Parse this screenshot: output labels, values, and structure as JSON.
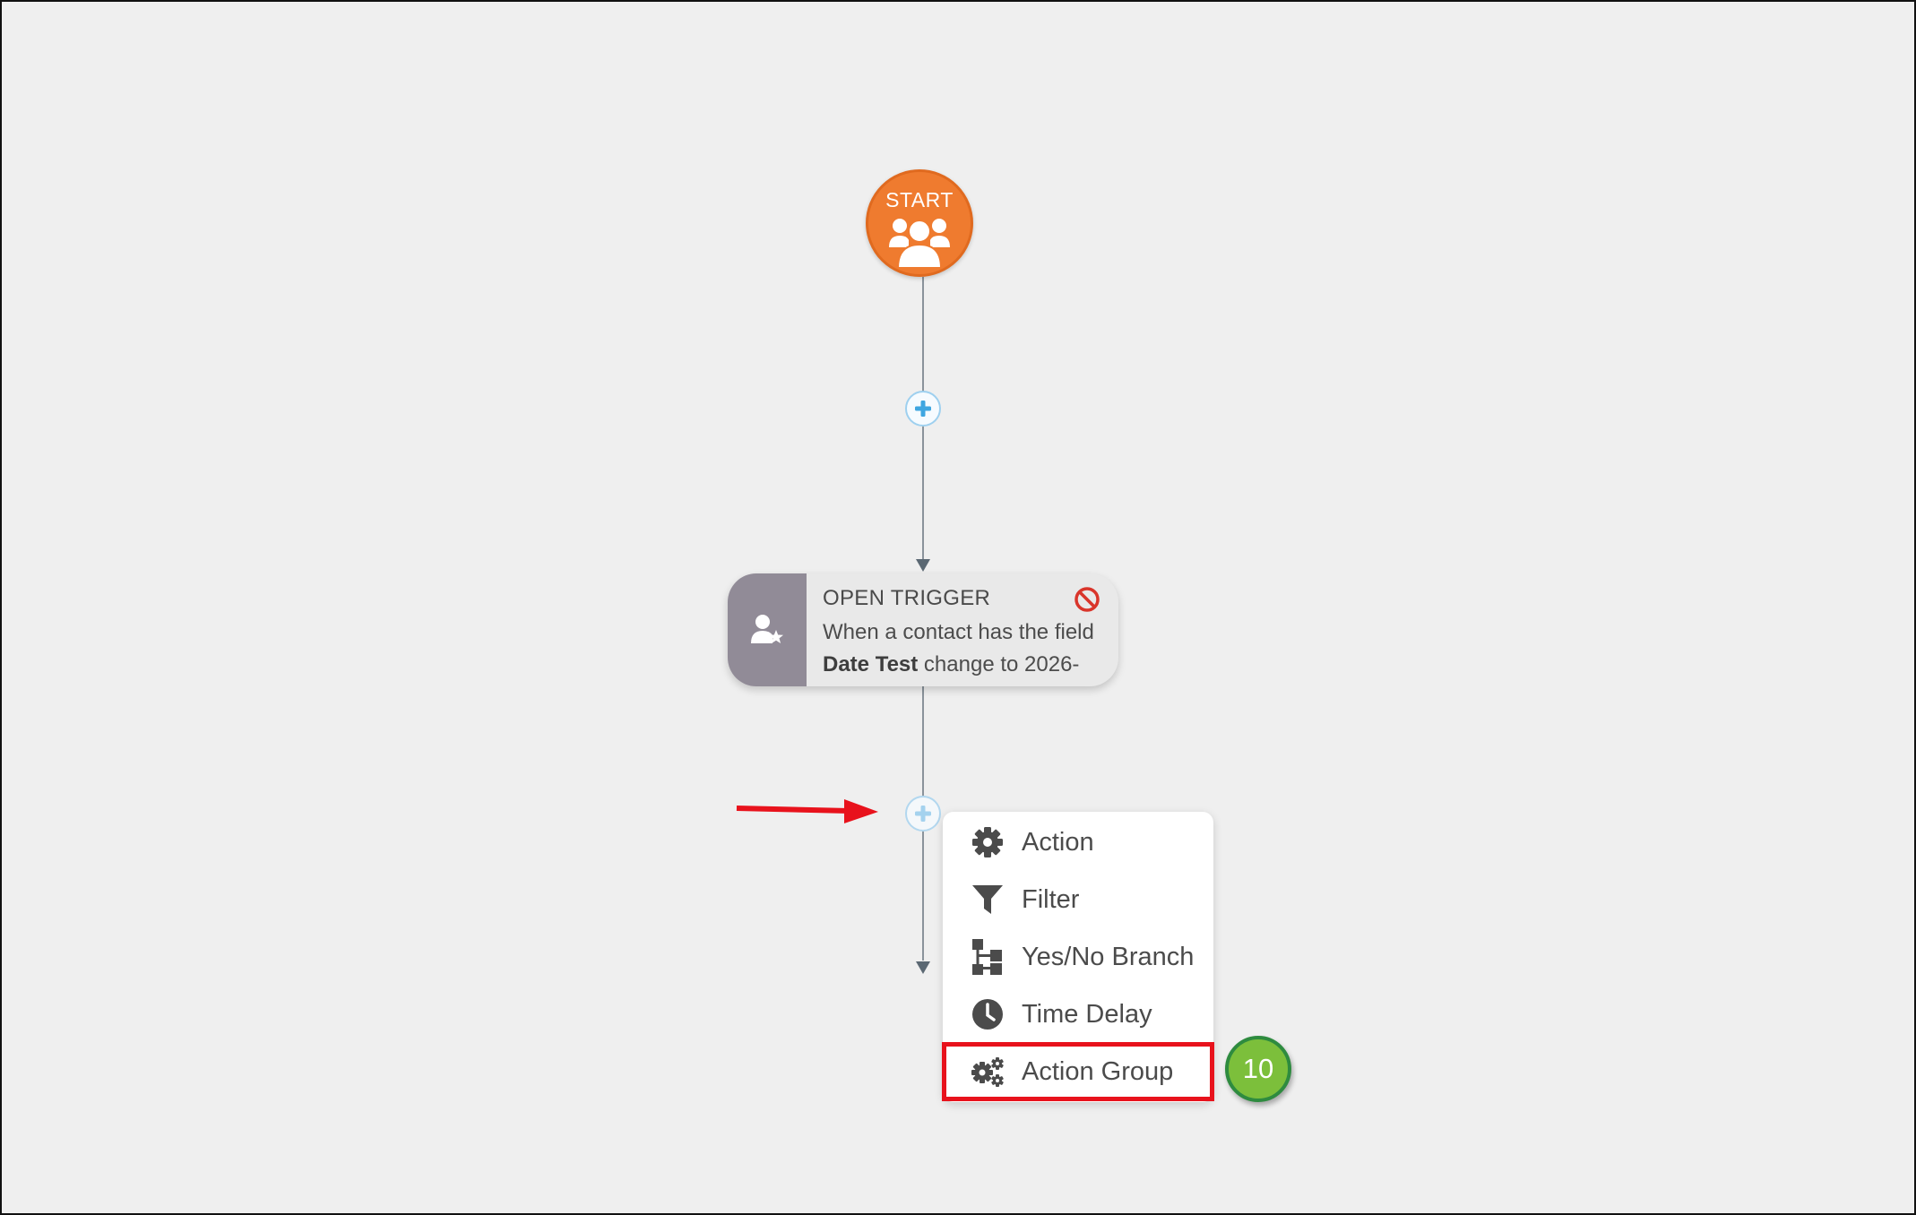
{
  "start_node": {
    "label": "START",
    "icon": "users-group-icon"
  },
  "trigger": {
    "title": "OPEN TRIGGER",
    "desc_line1": "When a contact has the field",
    "desc_field": "Date Test",
    "desc_line2_rest": " change to 2026-",
    "icon": "user-star-icon",
    "status_icon": "cancel-icon"
  },
  "add_menu": {
    "items": [
      {
        "label": "Action",
        "icon": "gear-icon"
      },
      {
        "label": "Filter",
        "icon": "funnel-icon"
      },
      {
        "label": "Yes/No Branch",
        "icon": "branch-icon"
      },
      {
        "label": "Time Delay",
        "icon": "clock-icon"
      },
      {
        "label": "Action Group",
        "icon": "gears-icon"
      }
    ]
  },
  "step_badge": "10",
  "colors": {
    "start": "#ef7b2f",
    "trigger_block": "#918b97",
    "highlight": "#e8121c",
    "badge": "#7cbf3b",
    "plus": "#3fa6e0"
  }
}
